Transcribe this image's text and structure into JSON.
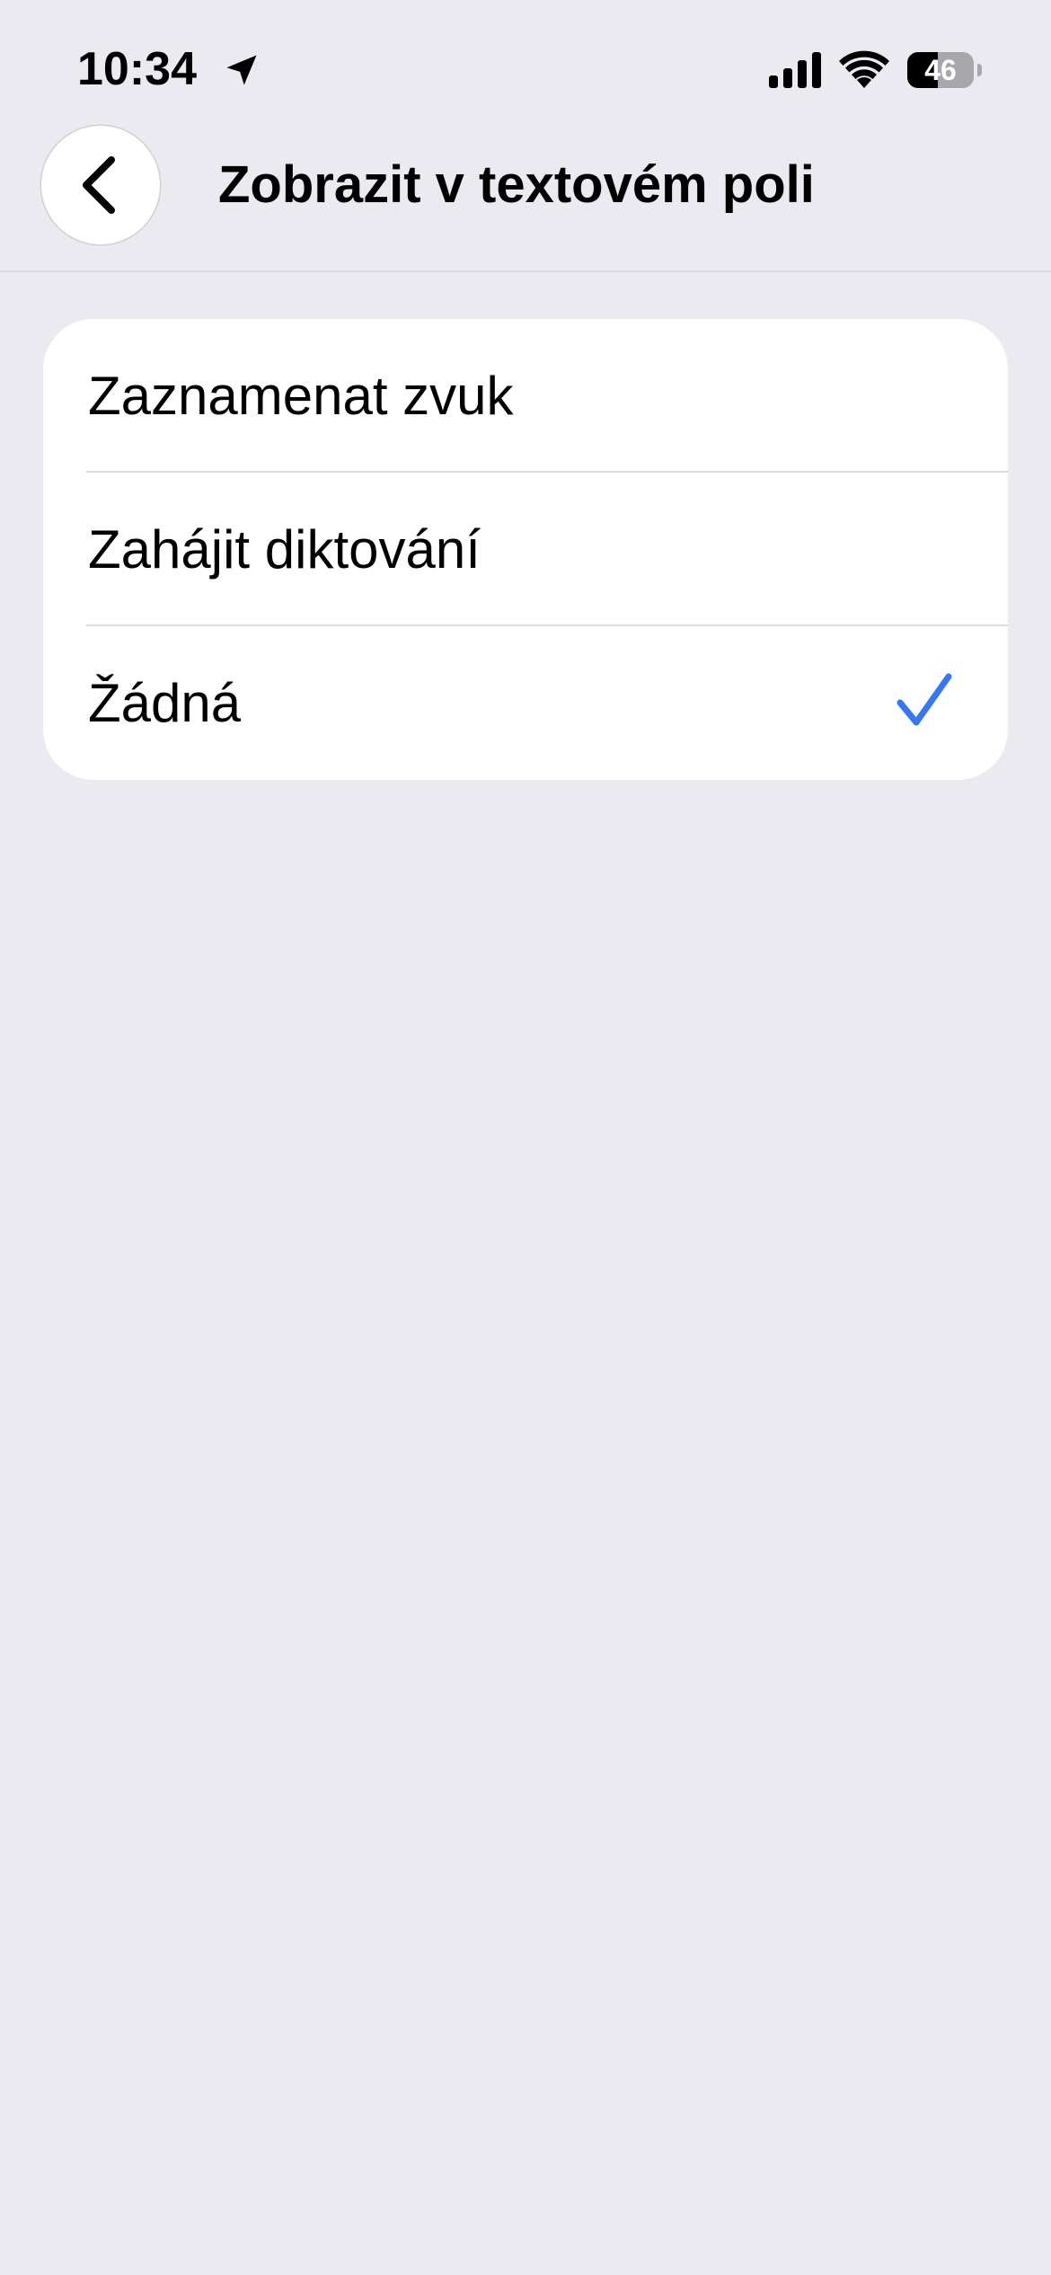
{
  "status_bar": {
    "time": "10:34",
    "battery_level": "46",
    "icons": [
      "location-arrow-icon",
      "cellular-signal-icon",
      "wifi-icon",
      "battery-icon"
    ]
  },
  "nav": {
    "title": "Zobrazit v textovém poli",
    "back_icon": "chevron-left-icon"
  },
  "options": [
    {
      "label": "Zaznamenat zvuk",
      "selected": false
    },
    {
      "label": "Zahájit diktování",
      "selected": false
    },
    {
      "label": "Žádná",
      "selected": true
    }
  ],
  "colors": {
    "background": "#EBEAF0",
    "card": "#FFFFFF",
    "accent": "#3478F6",
    "text": "#000000"
  }
}
